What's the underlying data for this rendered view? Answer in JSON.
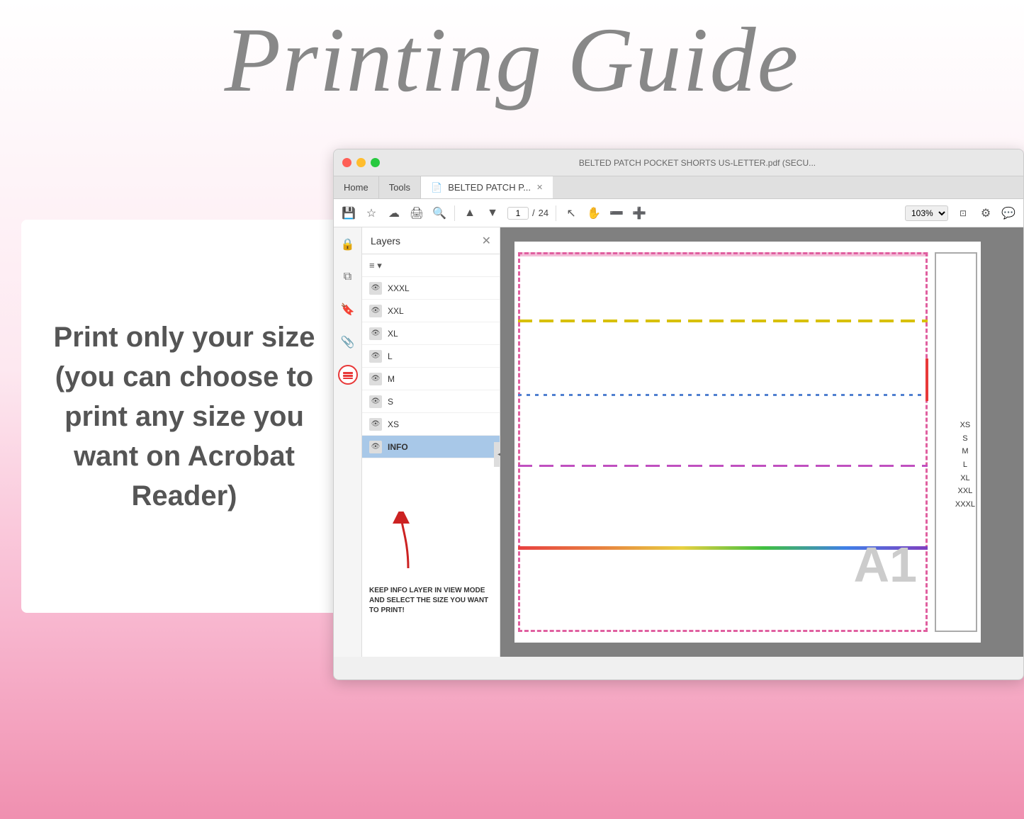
{
  "title": "Printing Guide",
  "left_box": {
    "text": "Print only your size (you can choose to print any size you want on Acrobat Reader)"
  },
  "window": {
    "title_bar_text": "BELTED PATCH POCKET SHORTS US-LETTER.pdf (SECU...",
    "tabs": [
      {
        "label": "Home",
        "active": false
      },
      {
        "label": "Tools",
        "active": false
      },
      {
        "label": "BELTED PATCH P...",
        "active": true
      }
    ],
    "toolbar": {
      "page_current": "1",
      "page_total": "24",
      "zoom": "103%"
    },
    "layers_panel": {
      "title": "Layers",
      "items": [
        {
          "name": "XXXL",
          "visible": true,
          "selected": false
        },
        {
          "name": "XXL",
          "visible": true,
          "selected": false
        },
        {
          "name": "XL",
          "visible": true,
          "selected": false
        },
        {
          "name": "L",
          "visible": true,
          "selected": false
        },
        {
          "name": "M",
          "visible": true,
          "selected": false
        },
        {
          "name": "S",
          "visible": true,
          "selected": false
        },
        {
          "name": "XS",
          "visible": true,
          "selected": false
        },
        {
          "name": "INFO",
          "visible": true,
          "selected": true
        }
      ]
    },
    "annotation": {
      "text": "KEEP INFO LAYER IN VIEW MODE AND SELECT THE SIZE YOU WANT TO PRINT!"
    },
    "size_labels": {
      "items": [
        "XS",
        "S",
        "M",
        "L",
        "XL",
        "XXL",
        "XXXL"
      ]
    }
  },
  "colors": {
    "background_gradient_top": "#ffffff",
    "background_gradient_bottom": "#f090b0",
    "accent_red": "#e83838",
    "layer_selected_bg": "#a8c8e8"
  }
}
